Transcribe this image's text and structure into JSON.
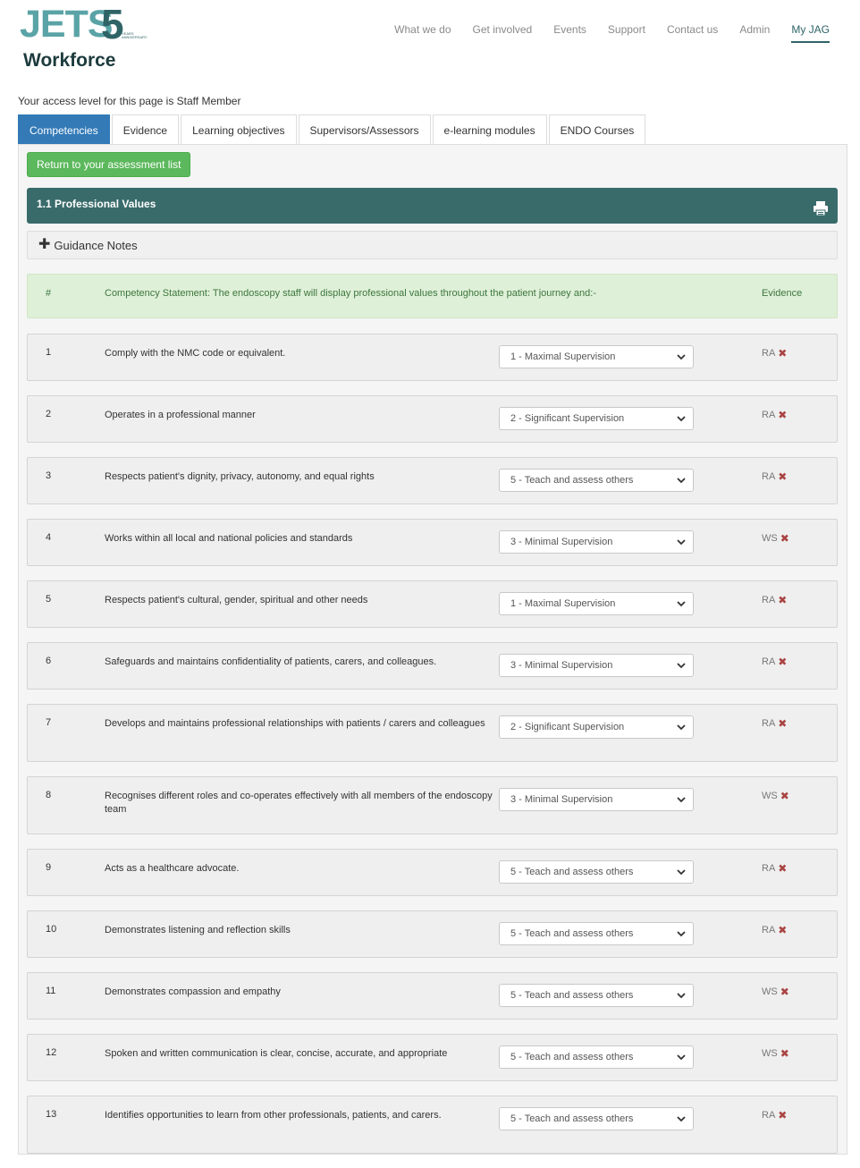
{
  "logo": {
    "brand": "JETS",
    "number": "5",
    "years": "YEARS ANNIVERSARY",
    "subtitle": "Workforce"
  },
  "nav": [
    "What we do",
    "Get involved",
    "Events",
    "Support",
    "Contact us",
    "Admin",
    "My JAG"
  ],
  "nav_active": "My JAG",
  "access_text": "Your access level for this page is Staff Member",
  "tabs": [
    "Competencies",
    "Evidence",
    "Learning objectives",
    "Supervisors/Assessors",
    "e-learning modules",
    "ENDO Courses"
  ],
  "return_button": "Return to your assessment list",
  "section_title": "1.1 Professional Values",
  "guidance_label": "Guidance Notes",
  "header_row": {
    "num": "#",
    "statement": "Competency Statement: The endoscopy staff will display professional values throughout the patient journey and:-",
    "evidence": "Evidence"
  },
  "rows": [
    {
      "num": "1",
      "text": "Comply with the NMC code or equivalent.",
      "level": "1 - Maximal Supervision",
      "evidence": "RA"
    },
    {
      "num": "2",
      "text": "Operates in a professional manner",
      "level": "2 - Significant Supervision",
      "evidence": "RA"
    },
    {
      "num": "3",
      "text": "Respects patient's dignity, privacy, autonomy, and equal rights",
      "level": "5 - Teach and assess others",
      "evidence": "RA"
    },
    {
      "num": "4",
      "text": "Works within all local and national policies and standards",
      "level": "3 - Minimal Supervision",
      "evidence": "WS"
    },
    {
      "num": "5",
      "text": "Respects patient's cultural, gender, spiritual and other needs",
      "level": "1 - Maximal Supervision",
      "evidence": "RA"
    },
    {
      "num": "6",
      "text": "Safeguards and maintains confidentiality of patients, carers, and colleagues.",
      "level": "3 - Minimal Supervision",
      "evidence": "RA"
    },
    {
      "num": "7",
      "text": "Develops and maintains professional relationships with patients / carers and colleagues",
      "level": "2 - Significant Supervision",
      "evidence": "RA"
    },
    {
      "num": "8",
      "text": "Recognises different roles and co-operates effectively with all members of the endoscopy team",
      "level": "3 - Minimal Supervision",
      "evidence": "WS"
    },
    {
      "num": "9",
      "text": "Acts as a healthcare advocate.",
      "level": "5 - Teach and assess others",
      "evidence": "RA"
    },
    {
      "num": "10",
      "text": "Demonstrates listening and reflection skills",
      "level": "5 - Teach and assess others",
      "evidence": "RA"
    },
    {
      "num": "11",
      "text": "Demonstrates compassion and empathy",
      "level": "5 - Teach and assess others",
      "evidence": "WS"
    },
    {
      "num": "12",
      "text": "Spoken and written communication is clear, concise, accurate, and appropriate",
      "level": "5 - Teach and assess others",
      "evidence": "WS"
    },
    {
      "num": "13",
      "text": "Identifies opportunities to learn from other professionals, patients, and carers.",
      "level": "5 - Teach and assess others",
      "evidence": "RA"
    }
  ],
  "icons": {
    "remove": "close-icon",
    "print": "print-icon",
    "expand": "plus-icon",
    "select": "chevron-down-icon"
  },
  "colors": {
    "teal": "#3a6b6b",
    "tab_active": "#337ab7",
    "green_button": "#5cb85c",
    "statement_bg": "#dff0d8",
    "remove_red": "#a94442"
  }
}
